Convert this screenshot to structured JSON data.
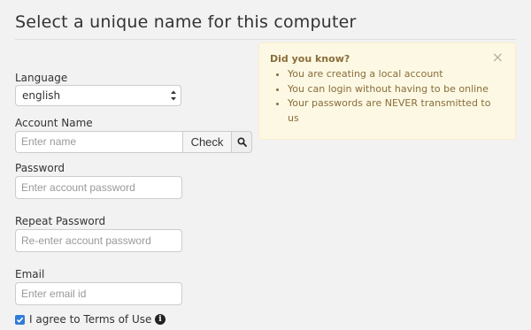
{
  "page": {
    "title": "Select a unique name for this computer"
  },
  "form": {
    "language": {
      "label": "Language",
      "selected": "english"
    },
    "account_name": {
      "label": "Account Name",
      "placeholder": "Enter name",
      "check_label": "Check",
      "search_icon": "search-icon"
    },
    "password": {
      "label": "Password",
      "placeholder": "Enter account password"
    },
    "repeat_password": {
      "label": "Repeat Password",
      "placeholder": "Re-enter account password"
    },
    "email": {
      "label": "Email",
      "placeholder": "Enter email id"
    },
    "terms": {
      "label": "I agree to Terms of Use",
      "checked": true,
      "info_icon": "info-icon"
    }
  },
  "tips": {
    "heading": "Did you know?",
    "close_symbol": "×",
    "items": [
      "You are creating a local account",
      "You can login without having to be online",
      "Your passwords are NEVER transmitted to us"
    ]
  },
  "colors": {
    "background": "#f2f2f2",
    "alert_background": "#fcf8e3",
    "alert_text": "#8a6d3b",
    "checkbox_accent": "#2f7dd6"
  }
}
